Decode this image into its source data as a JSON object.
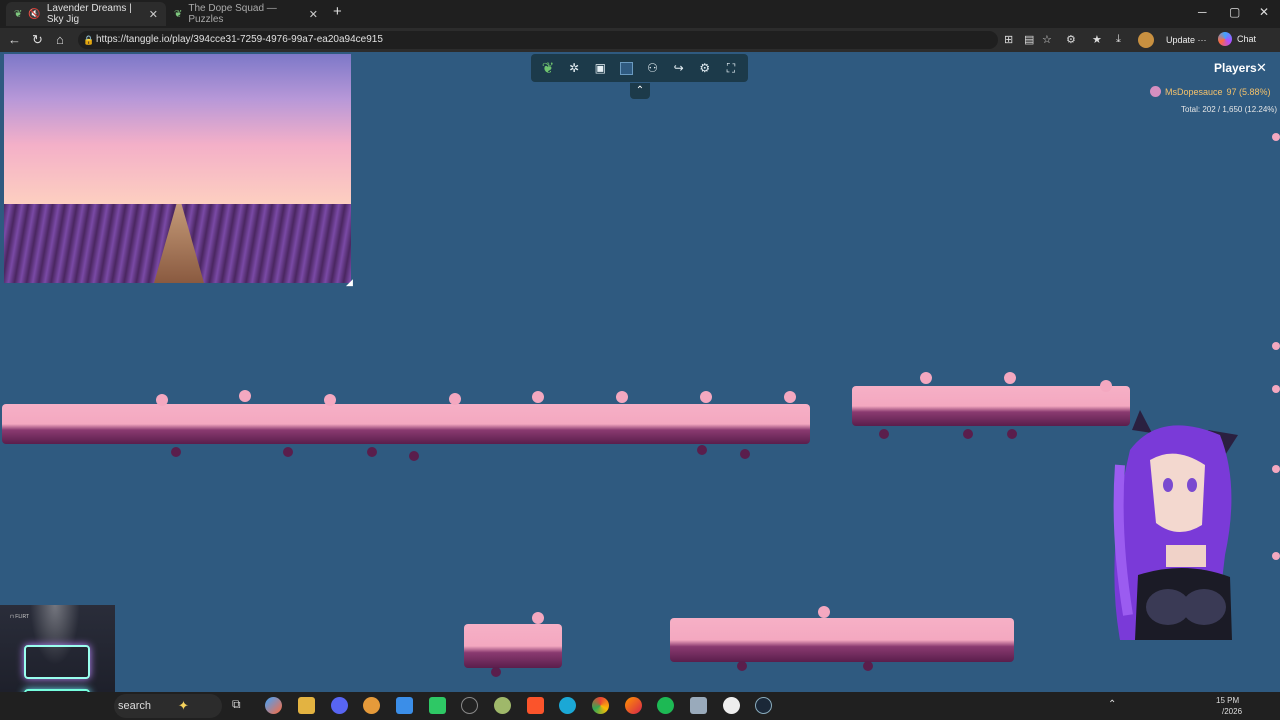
{
  "browser": {
    "tabs": [
      {
        "title": "Lavender Dreams | Sky Jig",
        "active": true
      },
      {
        "title": "The Dope Squad — Puzzles",
        "active": false
      }
    ],
    "url": "https://tanggle.io/play/394cce31-7259-4976-99a7-ea20a94ce915",
    "update_label": "Update",
    "more_label": "···",
    "chat_label": "Chat"
  },
  "game": {
    "players_title": "Players",
    "player": {
      "name": "MsDopesauce",
      "score": "97 (5.88%)"
    },
    "total": "Total: 202 / 1,650 (12.24%)"
  },
  "taskbar": {
    "search_placeholder": "search",
    "time": "15 PM",
    "date": "/2026"
  },
  "colors": {
    "board_bg": "#2f5a80",
    "piece_pink": "#f4a8c0",
    "piece_lavender": "#7a2e6a",
    "accent_gold": "#f5c26b"
  }
}
